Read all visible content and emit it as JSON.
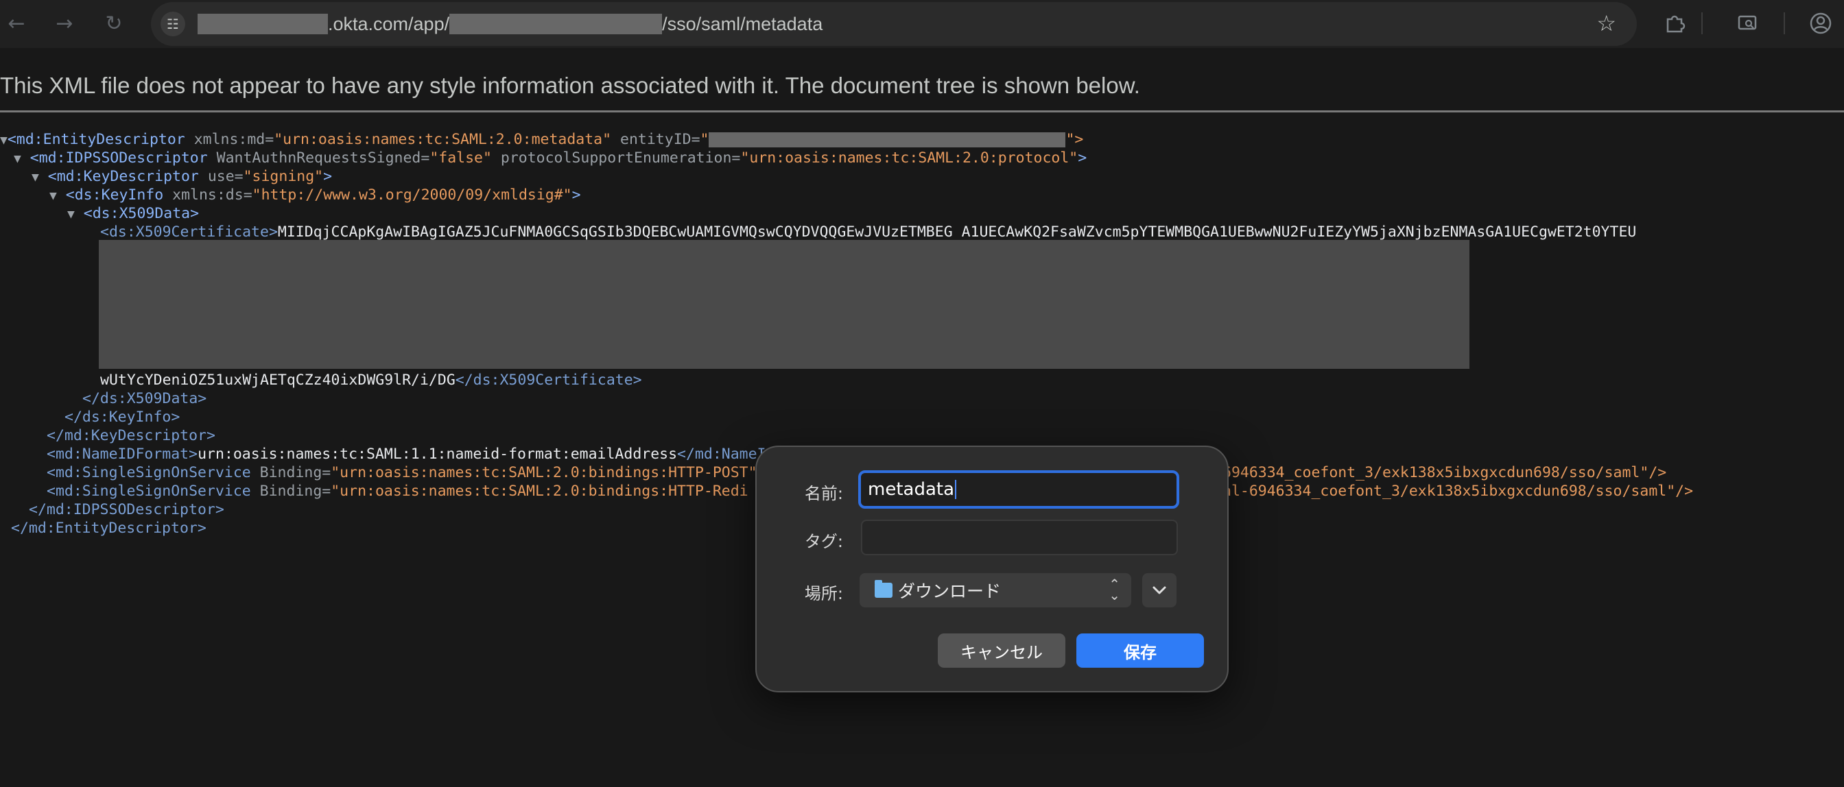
{
  "browser": {
    "url_prefix": ".okta.com/app/",
    "url_suffix": "/sso/saml/metadata",
    "icons": {
      "back": "arrow-left-icon",
      "forward": "arrow-right-icon",
      "reload": "reload-icon",
      "site_info": "tune-icon",
      "bookmark": "star-icon",
      "extensions": "puzzle-icon",
      "media": "cast-search-icon",
      "profile": "account-icon"
    }
  },
  "xml_viewer": {
    "notice": "This XML file does not appear to have any style information associated with it. The document tree is shown below.",
    "lines": {
      "l1_tag": "<md:EntityDescriptor",
      "l1_attr1": "xmlns:md=",
      "l1_val1": "\"urn:oasis:names:tc:SAML:2.0:metadata\"",
      "l1_attr2": "entityID=",
      "l1_val2_open": "\"",
      "l1_val2_close": "\">",
      "l2_tag": "<md:IDPSSODescriptor",
      "l2_attr1": "WantAuthnRequestsSigned=",
      "l2_val1": "\"false\"",
      "l2_attr2": "protocolSupportEnumeration=",
      "l2_val2": "\"urn:oasis:names:tc:SAML:2.0:protocol\"",
      "l2_end": ">",
      "l3_tag": "<md:KeyDescriptor",
      "l3_attr": "use=",
      "l3_val": "\"signing\"",
      "l3_end": ">",
      "l4_tag": "<ds:KeyInfo",
      "l4_attr": "xmlns:ds=",
      "l4_val": "\"http://www.w3.org/2000/09/xmldsig#\"",
      "l4_end": ">",
      "l5_tag": "<ds:X509Data>",
      "l6_tag": "<ds:X509Certificate>",
      "l6_text": "MIIDqjCCApKgAwIBAgIGAZ5JCuFNMA0GCSqGSIb3DQEBCwUAMIGVMQswCQYDVQQGEwJVUzETMBEG A1UECAwKQ2FsaWZvcm5pYTEWMBQGA1UEBwwNU2FuIEZyYW5jaXNjbzENMAsGA1UECgwET2t0YTEU",
      "l7_text": "wUtYcYDeniOZ51uxWjAETqCZz40ixDWG9lR/i/DG",
      "l7_close": "</ds:X509Certificate>",
      "l8_close": "</ds:X509Data>",
      "l9_close": "</ds:KeyInfo>",
      "l10_close": "</md:KeyDescriptor>",
      "l11_tag": "<md:NameIDFormat>",
      "l11_text": "urn:oasis:names:tc:SAML:1.1:nameid-format:emailAddress",
      "l11_close": "</md:NameI",
      "l12_tag": "<md:SingleSignOnService",
      "l12_attr": "Binding=",
      "l12_val": "\"urn:oasis:names:tc:SAML:2.0:bindings:HTTP-POST\"",
      "l12_tail": "6946334_coefont_3/exk138x5ibxgxcdun698/sso/saml\"/>",
      "l13_tag": "<md:SingleSignOnService",
      "l13_attr": "Binding=",
      "l13_val": "\"urn:oasis:names:tc:SAML:2.0:bindings:HTTP-Redi",
      "l13_tail": "al-6946334_coefont_3/exk138x5ibxgxcdun698/sso/saml\"/>",
      "l14_close": "</md:IDPSSODescriptor>",
      "l15_close": "</md:EntityDescriptor>"
    }
  },
  "save_dialog": {
    "name_label": "名前:",
    "name_value": "metadata",
    "tags_label": "タグ:",
    "location_label": "場所:",
    "location_value": "ダウンロード",
    "cancel_label": "キャンセル",
    "save_label": "保存",
    "accent_color": "#2f7cf6"
  }
}
